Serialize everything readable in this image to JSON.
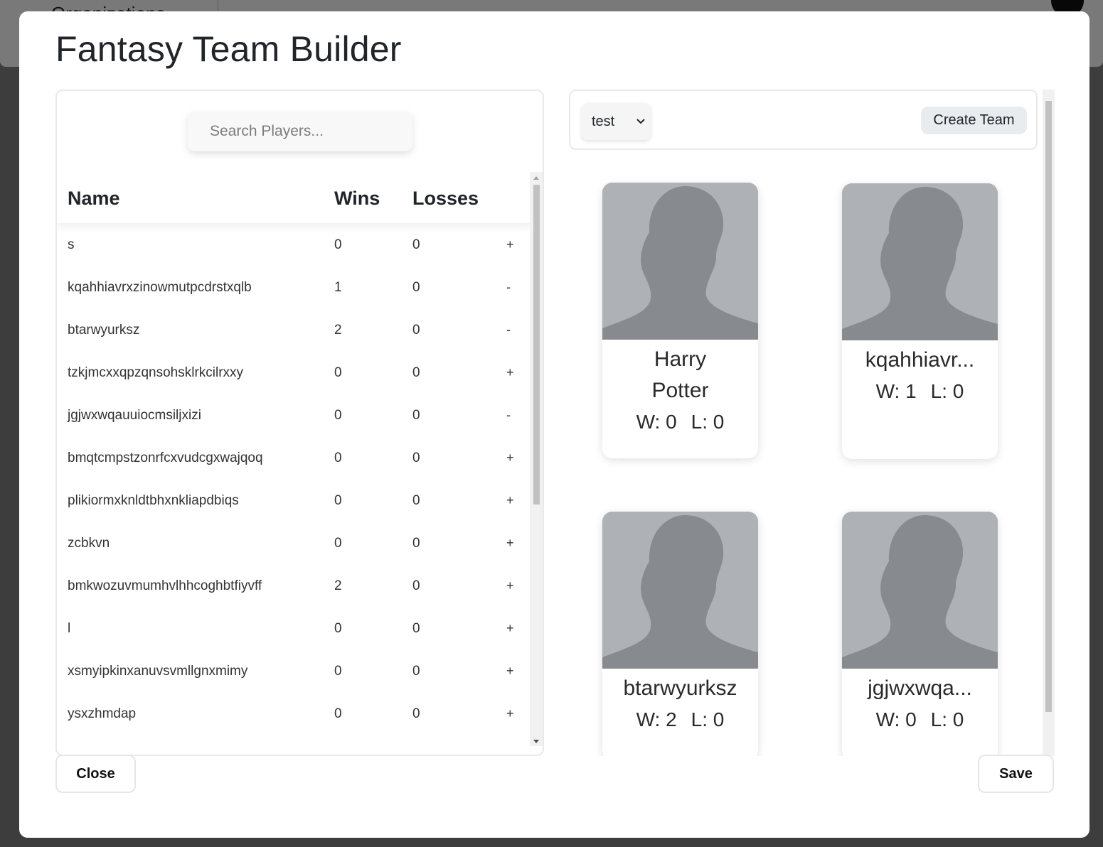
{
  "background": {
    "org_label": "Organizations"
  },
  "modal": {
    "title": "Fantasy Team Builder",
    "close_label": "Close",
    "save_label": "Save"
  },
  "players": {
    "search_placeholder": "Search Players...",
    "columns": {
      "name": "Name",
      "wins": "Wins",
      "losses": "Losses"
    },
    "rows": [
      {
        "name": "s",
        "wins": "0",
        "losses": "0",
        "action": "+"
      },
      {
        "name": "kqahhiavrxzinowmutpcdrstxqlb",
        "wins": "1",
        "losses": "0",
        "action": "-"
      },
      {
        "name": "btarwyurksz",
        "wins": "2",
        "losses": "0",
        "action": "-"
      },
      {
        "name": "tzkjmcxxqpzqnsohsklrkcilrxxy",
        "wins": "0",
        "losses": "0",
        "action": "+"
      },
      {
        "name": "jgjwxwqauuiocmsiljxizi",
        "wins": "0",
        "losses": "0",
        "action": "-"
      },
      {
        "name": "bmqtcmpstzonrfcxvudcgxwajqoq",
        "wins": "0",
        "losses": "0",
        "action": "+"
      },
      {
        "name": "plikiormxknldtbhxnkliapdbiqs",
        "wins": "0",
        "losses": "0",
        "action": "+"
      },
      {
        "name": "zcbkvn",
        "wins": "0",
        "losses": "0",
        "action": "+"
      },
      {
        "name": "bmkwozuvmumhvlhhcoghbtfiyvff",
        "wins": "2",
        "losses": "0",
        "action": "+"
      },
      {
        "name": "l",
        "wins": "0",
        "losses": "0",
        "action": "+"
      },
      {
        "name": "xsmyipkinxanuvsvmllgnxmimy",
        "wins": "0",
        "losses": "0",
        "action": "+"
      },
      {
        "name": "ysxzhmdap",
        "wins": "0",
        "losses": "0",
        "action": "+"
      }
    ]
  },
  "team": {
    "selected_team": "test",
    "create_label": "Create Team",
    "cards": [
      {
        "name": "Harry Potter",
        "wins": "W: 0",
        "losses": "L: 0"
      },
      {
        "name": "kqahhiavr...",
        "wins": "W: 1",
        "losses": "L: 0"
      },
      {
        "name": "btarwyurksz",
        "wins": "W: 2",
        "losses": "L: 0"
      },
      {
        "name": "jgjwxwqa...",
        "wins": "W: 0",
        "losses": "L: 0"
      }
    ]
  },
  "colors": {
    "photo_bg": "#aeb1b5",
    "silhouette": "#878a8f",
    "overlay": "#7a7a7a"
  }
}
